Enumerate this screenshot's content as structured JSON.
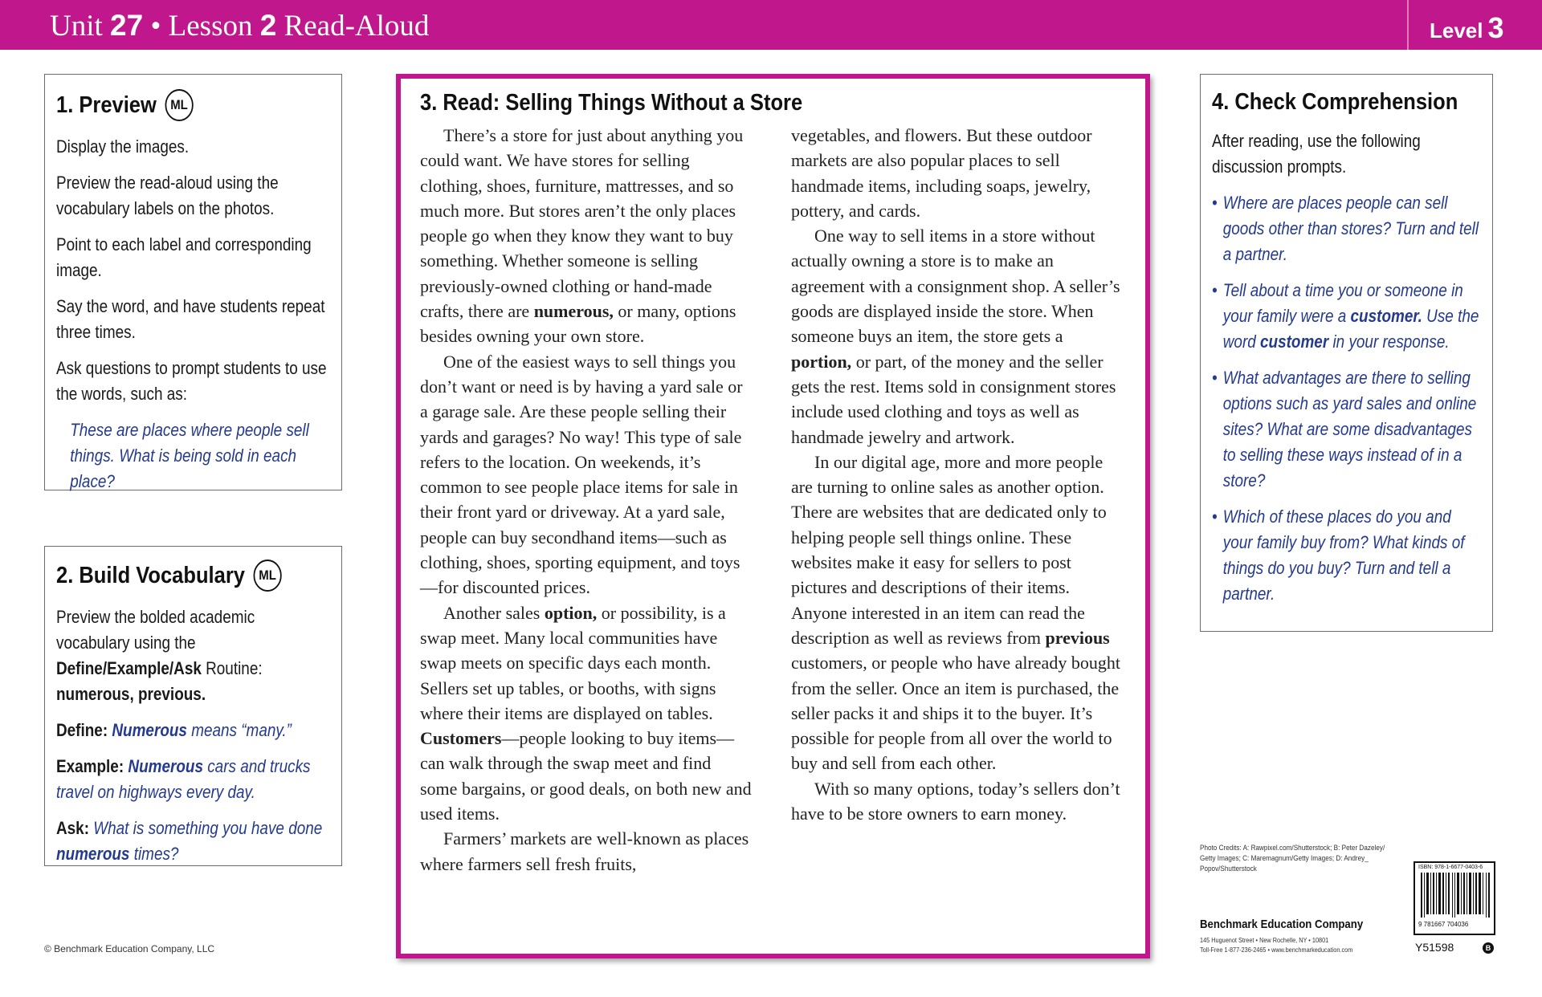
{
  "header": {
    "unit_label": "Unit",
    "unit_number": "27",
    "separator": "•",
    "lesson_label": "Lesson",
    "lesson_number": "2",
    "lesson_type": "Read-Aloud",
    "level_label": "Level",
    "level_number": "3"
  },
  "preview": {
    "title": "1. Preview",
    "badge": "ML",
    "p1": "Display the images.",
    "p2": "Preview the read-aloud using the vocabulary labels on the photos.",
    "p3": "Point to each label and corresponding image.",
    "p4": "Say the word, and have students repeat three times.",
    "p5": "Ask questions to prompt students to use the words, such as:",
    "quote": "These are places where people sell things. What is being sold in each place?"
  },
  "vocab": {
    "title": "2. Build Vocabulary",
    "badge": "ML",
    "intro_a": "Preview the bolded academic vocabulary using the ",
    "intro_routine": "Define/Example/Ask",
    "intro_b": " Routine:",
    "words": "numerous, previous.",
    "define_label": "Define:",
    "define_word": "Numerous",
    "define_text": " means “many.”",
    "example_label": "Example:",
    "example_word": "Numerous",
    "example_text": " cars and trucks travel on highways every day.",
    "ask_label": "Ask:",
    "ask_text_a": " What is something you have done ",
    "ask_word": "numerous",
    "ask_text_b": " times?"
  },
  "read": {
    "title": "3. Read: Selling Things Without a Store",
    "c1_p1a": "There’s a store for just about anything you could want. We have stores for selling clothing, shoes, furniture, mattresses, and so much more. But stores aren’t the only places people go when they know they want to buy something. Whether someone is selling previously-owned clothing or hand-made crafts, there are ",
    "c1_p1_word": "numerous,",
    "c1_p1b": " or many, options besides owning your own store.",
    "c1_p2": "One of the easiest ways to sell things you don’t want or need is by having a yard sale or a garage sale. Are these people selling their yards and garages? No way! This type of sale refers to the location. On weekends, it’s common to see people place items for sale in their front yard or driveway. At a yard sale, people can buy secondhand items—such as clothing, shoes, sporting equipment, and toys—for discounted prices.",
    "c1_p3a": "Another sales ",
    "c1_p3_word": "option,",
    "c1_p3b": " or possibility, is a swap meet. Many local communities have swap meets on specific days each month. Sellers set up tables, or booths, with signs where their items are displayed on tables. ",
    "c1_p3_word2": "Customers",
    "c1_p3c": "—people looking to buy items—can walk through the swap meet and find some bargains, or good deals, on both new and used items.",
    "c1_p4": "Farmers’ markets are well-known as places where farmers sell fresh fruits,",
    "c2_p1": "vegetables, and flowers. But these outdoor markets are also popular places to sell handmade items, including soaps, jewelry, pottery, and cards.",
    "c2_p2a": "One way to sell items in a store without actually owning a store is to make an agreement with a consignment shop. A seller’s goods are displayed inside the store. When someone buys an item, the store gets a ",
    "c2_p2_word": "portion,",
    "c2_p2b": " or part, of the money and the seller gets the rest. Items sold in consignment stores include used clothing and toys as well as handmade jewelry and artwork.",
    "c2_p3a": "In our digital age, more and more people are turning to online sales as another option. There are websites that are dedicated only to helping people sell things online. These websites make it easy for sellers to post pictures and descriptions of their items. Anyone interested in an item can read the description as well as reviews from ",
    "c2_p3_word": "previous",
    "c2_p3b": " customers, or people who have already bought from the seller. Once an item is purchased, the seller packs it and ships it to the buyer. It’s possible for people from all over the world to buy and sell from each other.",
    "c2_p4": "With so many options, today’s sellers don’t have to be store owners to earn money."
  },
  "check": {
    "title": "4. Check Comprehension",
    "intro": "After reading, use the following discussion prompts.",
    "bullet": "•",
    "q1": "Where are places people can sell goods other than stores? Turn and tell a partner.",
    "q2a": "Tell about a time you or someone in your family were a ",
    "q2_word": "customer.",
    "q2b": " Use the word ",
    "q2_word2": "customer",
    "q2c": " in your response.",
    "q3": "What advantages are there to selling options such as yard sales and online sites? What are some disadvantages to selling these ways instead of in a store?",
    "q4": "Which of these places do you and your family buy from? What kinds of things do you buy? Turn and tell a partner."
  },
  "footer": {
    "copyright": "© Benchmark Education Company, LLC",
    "credits": "Photo Credits: A: Rawpixel.com/Shutterstock; B: Peter Dazeley/ Getty Images; C: Maremagnum/Getty Images; D: Andrey_ Popov/Shutterstock",
    "company": "Benchmark Education Company",
    "address": "145 Huguenot Street • New Rochelle, NY • 10801",
    "tollfree": "Toll-Free 1-877-236-2465 • www.benchmarkeducation.com",
    "barcode_top": "ISBN: 978-1-6677-0403-6",
    "barcode_number": "9 781667 704036",
    "product_code": "Y51598",
    "mark": "B"
  }
}
